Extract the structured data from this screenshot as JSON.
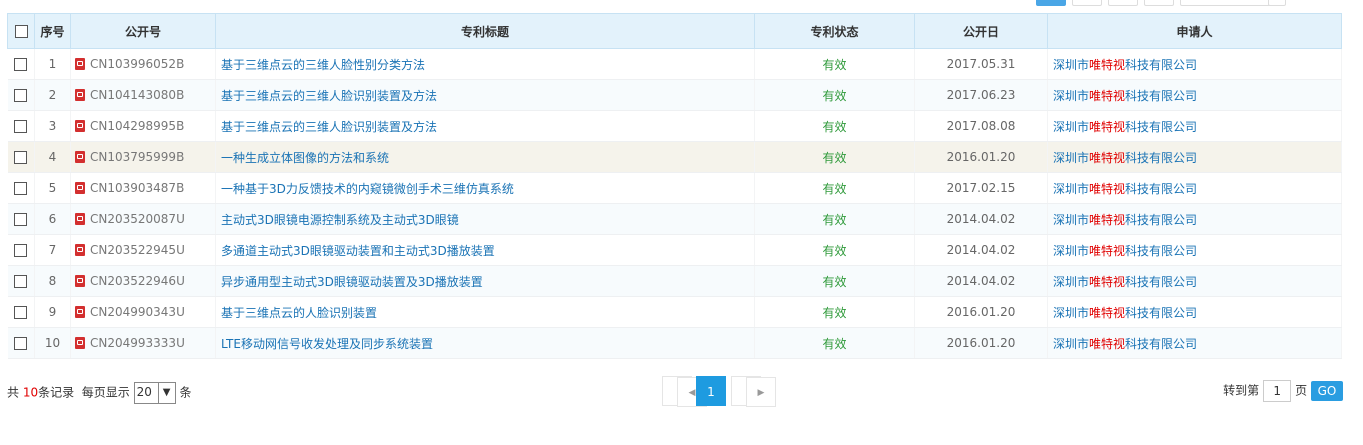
{
  "table": {
    "headers": {
      "index": "序号",
      "pub_no": "公开号",
      "title": "专利标题",
      "status": "专利状态",
      "pub_date": "公开日",
      "applicant": "申请人"
    },
    "rows": [
      {
        "index": "1",
        "pub_no": "CN103996052B",
        "title": "基于三维点云的三维人脸性别分类方法",
        "status": "有效",
        "pub_date": "2017.05.31",
        "applicant_pre": "深圳市",
        "applicant_hit": "唯特视",
        "applicant_post": "科技有限公司"
      },
      {
        "index": "2",
        "pub_no": "CN104143080B",
        "title": "基于三维点云的三维人脸识别装置及方法",
        "status": "有效",
        "pub_date": "2017.06.23",
        "applicant_pre": "深圳市",
        "applicant_hit": "唯特视",
        "applicant_post": "科技有限公司"
      },
      {
        "index": "3",
        "pub_no": "CN104298995B",
        "title": "基于三维点云的三维人脸识别装置及方法",
        "status": "有效",
        "pub_date": "2017.08.08",
        "applicant_pre": "深圳市",
        "applicant_hit": "唯特视",
        "applicant_post": "科技有限公司"
      },
      {
        "index": "4",
        "pub_no": "CN103795999B",
        "title": "一种生成立体图像的方法和系统",
        "status": "有效",
        "pub_date": "2016.01.20",
        "applicant_pre": "深圳市",
        "applicant_hit": "唯特视",
        "applicant_post": "科技有限公司"
      },
      {
        "index": "5",
        "pub_no": "CN103903487B",
        "title": "一种基于3D力反馈技术的内窥镜微创手术三维仿真系统",
        "status": "有效",
        "pub_date": "2017.02.15",
        "applicant_pre": "深圳市",
        "applicant_hit": "唯特视",
        "applicant_post": "科技有限公司"
      },
      {
        "index": "6",
        "pub_no": "CN203520087U",
        "title": "主动式3D眼镜电源控制系统及主动式3D眼镜",
        "status": "有效",
        "pub_date": "2014.04.02",
        "applicant_pre": "深圳市",
        "applicant_hit": "唯特视",
        "applicant_post": "科技有限公司"
      },
      {
        "index": "7",
        "pub_no": "CN203522945U",
        "title": "多通道主动式3D眼镜驱动装置和主动式3D播放装置",
        "status": "有效",
        "pub_date": "2014.04.02",
        "applicant_pre": "深圳市",
        "applicant_hit": "唯特视",
        "applicant_post": "科技有限公司"
      },
      {
        "index": "8",
        "pub_no": "CN203522946U",
        "title": "异步通用型主动式3D眼镜驱动装置及3D播放装置",
        "status": "有效",
        "pub_date": "2014.04.02",
        "applicant_pre": "深圳市",
        "applicant_hit": "唯特视",
        "applicant_post": "科技有限公司"
      },
      {
        "index": "9",
        "pub_no": "CN204990343U",
        "title": "基于三维点云的人脸识别装置",
        "status": "有效",
        "pub_date": "2016.01.20",
        "applicant_pre": "深圳市",
        "applicant_hit": "唯特视",
        "applicant_post": "科技有限公司"
      },
      {
        "index": "10",
        "pub_no": "CN204993333U",
        "title": "LTE移动网信号收发处理及同步系统装置",
        "status": "有效",
        "pub_date": "2016.01.20",
        "applicant_pre": "深圳市",
        "applicant_hit": "唯特视",
        "applicant_post": "科技有限公司"
      }
    ]
  },
  "footer": {
    "total_prefix": "共 ",
    "total_count": "10",
    "total_suffix": "条记录",
    "per_page_label": "每页显示",
    "per_page_value": "20",
    "per_page_unit": "条",
    "page_prev": "◀",
    "page_current": "1",
    "page_next": "▶",
    "goto_label": "转到第",
    "goto_value": "1",
    "goto_unit": "页",
    "go_label": "GO"
  },
  "colors": {
    "header_bg": "#e3f2fb",
    "link": "#1a73b5",
    "status": "#2f9a3a",
    "highlight": "#e00000",
    "accent": "#1e9be0"
  }
}
